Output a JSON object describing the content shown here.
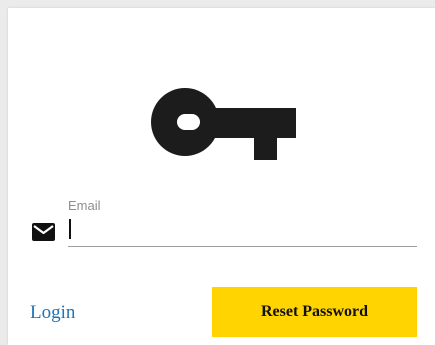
{
  "form": {
    "icon_name": "key-icon",
    "email": {
      "label": "Email",
      "value": "",
      "icon_name": "mail-icon"
    },
    "login_link": "Login",
    "reset_button": "Reset Password"
  },
  "colors": {
    "page_background": "#ebebeb",
    "card_background": "#ffffff",
    "accent_button": "#ffd400",
    "link": "#1f73b7",
    "icon": "#1c1c1c"
  }
}
